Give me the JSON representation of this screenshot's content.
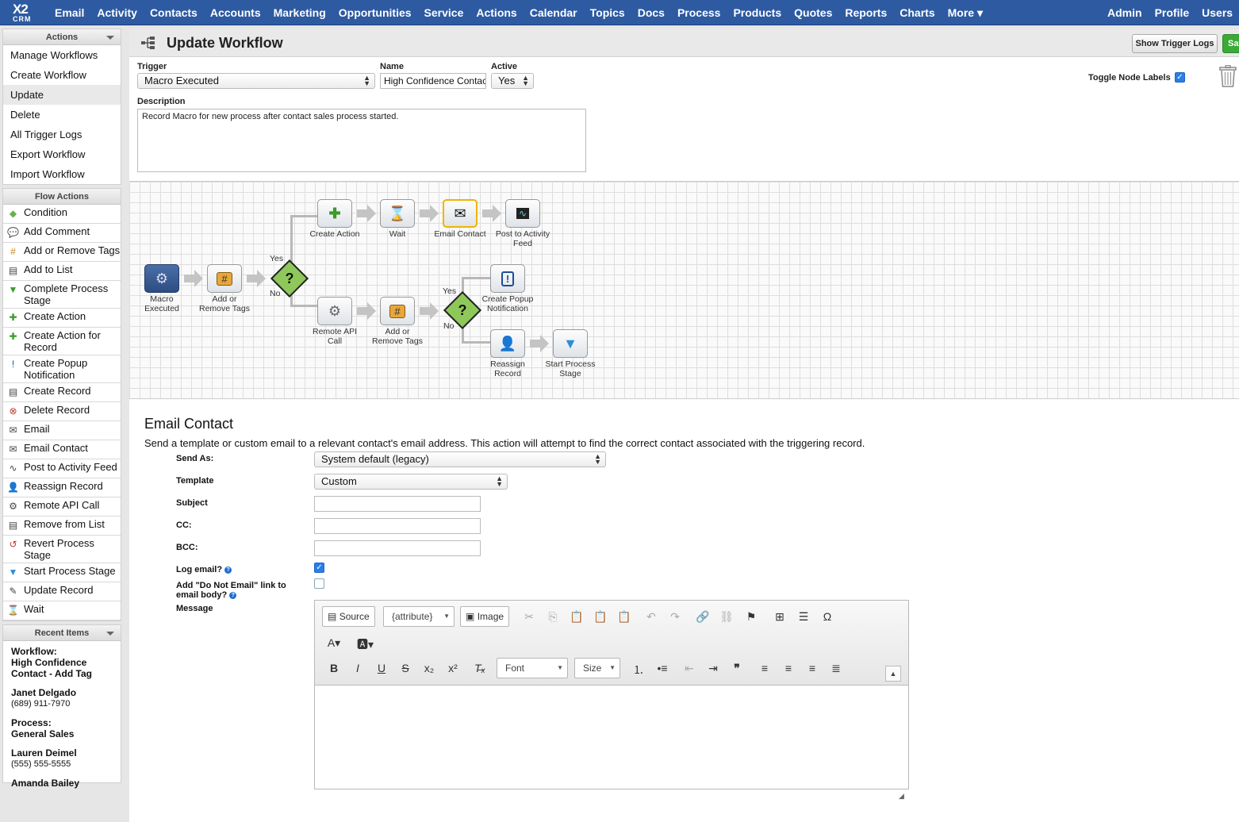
{
  "brand": {
    "logo_top": "X2",
    "logo_bottom": "CRM"
  },
  "nav": {
    "items": [
      "Email",
      "Activity",
      "Contacts",
      "Accounts",
      "Marketing",
      "Opportunities",
      "Service",
      "Actions",
      "Calendar",
      "Topics",
      "Docs",
      "Process",
      "Products",
      "Quotes",
      "Reports",
      "Charts",
      "More ▾"
    ],
    "right": [
      "Admin",
      "Profile",
      "Users"
    ]
  },
  "sidebar": {
    "actions_title": "Actions",
    "actions": [
      "Manage Workflows",
      "Create Workflow",
      "Update",
      "Delete",
      "All Trigger Logs",
      "Export Workflow",
      "Import Workflow"
    ],
    "flow_title": "Flow Actions",
    "flow": [
      {
        "label": "Condition",
        "icon": "condition-icon"
      },
      {
        "label": "Add Comment",
        "icon": "comment-icon"
      },
      {
        "label": "Add or Remove Tags",
        "icon": "tag-icon"
      },
      {
        "label": "Add to List",
        "icon": "list-add-icon"
      },
      {
        "label": "Complete Process Stage",
        "icon": "funnel-check-icon"
      },
      {
        "label": "Create Action",
        "icon": "create-action-icon"
      },
      {
        "label": "Create Action for Record",
        "icon": "create-action-record-icon"
      },
      {
        "label": "Create Popup Notification",
        "icon": "popup-icon"
      },
      {
        "label": "Create Record",
        "icon": "create-record-icon"
      },
      {
        "label": "Delete Record",
        "icon": "delete-record-icon"
      },
      {
        "label": "Email",
        "icon": "email-icon"
      },
      {
        "label": "Email Contact",
        "icon": "email-contact-icon"
      },
      {
        "label": "Post to Activity Feed",
        "icon": "activity-feed-icon"
      },
      {
        "label": "Reassign Record",
        "icon": "reassign-icon"
      },
      {
        "label": "Remote API Call",
        "icon": "gears-icon"
      },
      {
        "label": "Remove from List",
        "icon": "list-remove-icon"
      },
      {
        "label": "Revert Process Stage",
        "icon": "revert-icon"
      },
      {
        "label": "Start Process Stage",
        "icon": "funnel-play-icon"
      },
      {
        "label": "Update Record",
        "icon": "update-record-icon"
      },
      {
        "label": "Wait",
        "icon": "hourglass-icon"
      }
    ],
    "recent_title": "Recent Items",
    "recent": [
      {
        "title": "Workflow:\nHigh Confidence Contact - Add Tag",
        "phone": ""
      },
      {
        "title": "Janet Delgado",
        "phone": "(689) 911-7970"
      },
      {
        "title": "Process:\nGeneral Sales",
        "phone": ""
      },
      {
        "title": "Lauren Deimel",
        "phone": "(555) 555-5555"
      },
      {
        "title": "Amanda Bailey",
        "phone": ""
      }
    ]
  },
  "header": {
    "title": "Update Workflow",
    "show_logs": "Show Trigger Logs",
    "save": "Save"
  },
  "form": {
    "trigger_label": "Trigger",
    "trigger_value": "Macro Executed",
    "name_label": "Name",
    "name_value": "High Confidence Contact - Add Tag",
    "active_label": "Active",
    "active_value": "Yes",
    "toggle_label": "Toggle Node Labels",
    "desc_label": "Description",
    "desc_value": "Record Macro for new process after contact sales process started."
  },
  "flow": {
    "nodes": {
      "macro": "Macro\nExecuted",
      "tags1": "Add or\nRemove Tags",
      "create_action": "Create Action",
      "wait": "Wait",
      "email_contact": "Email Contact",
      "post_feed": "Post to Activity\nFeed",
      "remote_api": "Remote API\nCall",
      "tags2": "Add or\nRemove Tags",
      "popup": "Create Popup\nNotification",
      "reassign": "Reassign\nRecord",
      "start_stage": "Start Process\nStage"
    },
    "yes": "Yes",
    "no": "No"
  },
  "email": {
    "title": "Email Contact",
    "description": "Send a template or custom email to a relevant contact's email address. This action will attempt to find the correct contact associated with the triggering record.",
    "send_as_label": "Send As:",
    "send_as_value": "System default (legacy)",
    "template_label": "Template",
    "template_value": "Custom",
    "subject_label": "Subject",
    "cc_label": "CC:",
    "bcc_label": "BCC:",
    "log_label": "Log email?",
    "dne_label": "Add \"Do Not Email\" link to email body?",
    "message_label": "Message"
  },
  "editor": {
    "source": "Source",
    "attribute": "{attribute}",
    "image": "Image",
    "font": "Font",
    "size": "Size"
  }
}
